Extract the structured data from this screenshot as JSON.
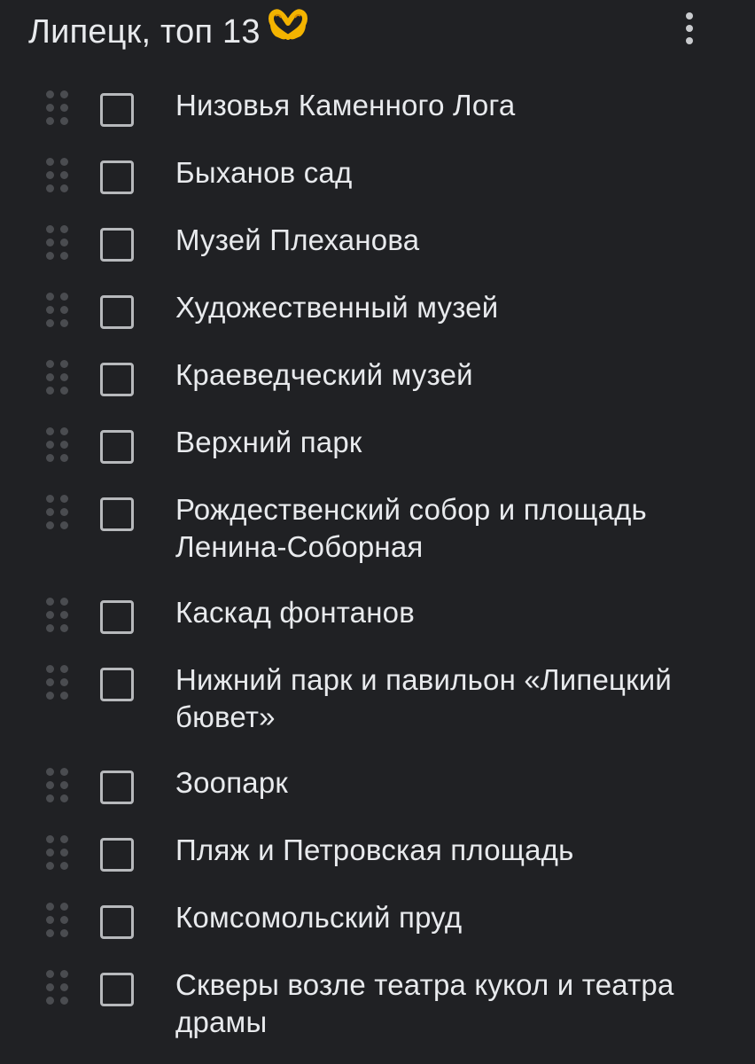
{
  "header": {
    "title": "Липецк, топ 13",
    "emoji": "heart-hands-emoji",
    "more_icon": "more-vert-icon"
  },
  "colors": {
    "background": "#202124",
    "text": "#e8eaed",
    "checkbox_border": "#b7b9bc",
    "handle": "#4a4c50",
    "emoji": "#f4b400"
  },
  "items": [
    {
      "label": "Низовья Каменного Лога",
      "checked": false
    },
    {
      "label": "Быханов сад",
      "checked": false
    },
    {
      "label": "Музей Плеханова",
      "checked": false
    },
    {
      "label": "Художественный музей",
      "checked": false
    },
    {
      "label": "Краеведческий музей",
      "checked": false
    },
    {
      "label": "Верхний парк",
      "checked": false
    },
    {
      "label": "Рождественский собор и площадь Ленина-Соборная",
      "checked": false
    },
    {
      "label": "Каскад фонтанов",
      "checked": false
    },
    {
      "label": "Нижний парк и павильон «Липецкий бювет»",
      "checked": false
    },
    {
      "label": "Зоопарк",
      "checked": false
    },
    {
      "label": "Пляж и Петровская площадь",
      "checked": false
    },
    {
      "label": "Комсомольский пруд",
      "checked": false
    },
    {
      "label": "Скверы возле театра кукол и театра драмы",
      "checked": false
    }
  ]
}
